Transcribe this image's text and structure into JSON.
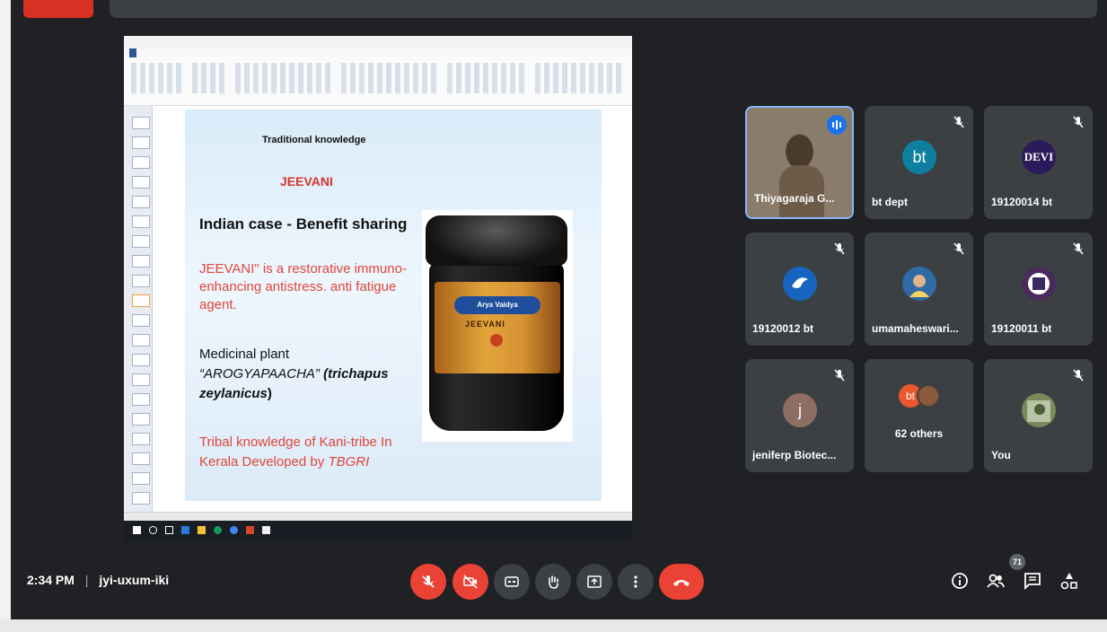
{
  "slide": {
    "title": "Traditional knowledge",
    "name": "JEEVANI",
    "heading": "Indian case - Benefit sharing",
    "para1": "JEEVANI\"  is a restorative immuno-enhancing antistress. anti fatigue agent.",
    "plant_line1": "Medicinal plant",
    "plant_name": "“AROGYAPAACHA”",
    "plant_latin": "(trichapus zeylanicus",
    "plant_close": ")",
    "para2_a": "Tribal knowledge of Kani-tribe In Kerala Developed by ",
    "para2_b": "TBGRI",
    "jar_brand": "Arya Vaidya",
    "jar_name": "JEEVANI"
  },
  "participants": [
    {
      "name": "Thiyagaraja G...",
      "type": "video",
      "speaking": true
    },
    {
      "name": "bt dept",
      "avatar_text": "bt",
      "avatar_color": "#0e7fa0",
      "muted": true
    },
    {
      "name": "19120014 bt",
      "avatar_text": "DEVI",
      "avatar_color": "#2b1b5b",
      "muted": true
    },
    {
      "name": "19120012 bt",
      "avatar_type": "bird",
      "avatar_color": "#1565c0",
      "muted": true
    },
    {
      "name": "umamaheswari...",
      "avatar_type": "photo",
      "avatar_color": "#2f6aa7",
      "muted": true
    },
    {
      "name": "19120011 bt",
      "avatar_type": "photo",
      "avatar_color": "#4a2a5a",
      "muted": true
    },
    {
      "name": "jeniferp Biotec...",
      "avatar_text": "j",
      "avatar_color": "#8d6e63",
      "muted": true
    },
    {
      "name": "62 others",
      "avatar_text": "bt",
      "avatar_color": "#e8572d",
      "muted": false
    },
    {
      "name": "You",
      "avatar_type": "photo",
      "avatar_color": "#7a8a5a",
      "muted": true
    }
  ],
  "meeting": {
    "time": "2:34 PM",
    "separator": "|",
    "code": "jyi-uxum-iki",
    "people_count": "71"
  },
  "colors": {
    "background": "#202124",
    "tile": "#3c4043",
    "red": "#ea4335",
    "accent": "#8ab4f8"
  },
  "icons": [
    "mic-off-icon",
    "camera-off-icon",
    "captions-icon",
    "raise-hand-icon",
    "present-icon",
    "more-icon",
    "hang-up-icon",
    "info-icon",
    "people-icon",
    "chat-icon",
    "activities-icon"
  ]
}
